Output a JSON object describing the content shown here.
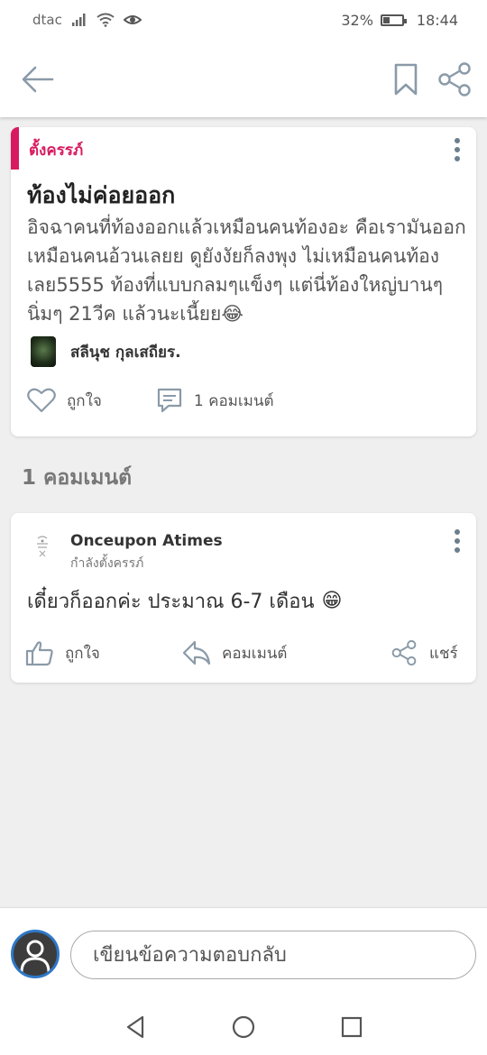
{
  "status_bar": {
    "carrier": "dtac",
    "battery_percent": "32%",
    "battery_level": 0.32,
    "time": "18:44",
    "icons": [
      "signal-icon",
      "wifi-icon",
      "eye-icon",
      "battery-icon"
    ]
  },
  "app_bar": {
    "icons": [
      "back-arrow-icon",
      "bookmark-icon",
      "share-icon"
    ],
    "icon_color": "#8a9aa8"
  },
  "post": {
    "category": "ตั้งครรภ์",
    "category_color": "#d81b60",
    "title": "ท้องไม่ค่อยออก",
    "body": "อิจฉาคนที่ท้องออกแล้วเหมือนคนท้องอะ คือเรามันออกเหมือนคนอ้วนเลยย ดูยังงัยก็ลงพุง ไม่เหมือนคนท้องเลย5555 ท้องที่แบบกลมๆแข็งๆ แต่นี่ท้องใหญ่บานๆนิ่มๆ 21วีค แล้วนะเนี้ยย😂",
    "author": "สลีนุช กุลเสถียร.",
    "like_label": "ถูกใจ",
    "comment_label": "1 คอมเมนต์"
  },
  "comments_section": {
    "heading": "1 คอมเมนต์"
  },
  "comment": {
    "name": "Onceupon Atimes",
    "status": "กำลังตั้งครรภ์",
    "text": "เดี๋ยวก็ออกค่ะ ประมาณ 6-7 เดือน",
    "emoji": "😁",
    "like_label": "ถูกใจ",
    "reply_label": "คอมเมนต์",
    "share_label": "แชร์"
  },
  "reply_bar": {
    "placeholder": "เขียนข้อความตอบกลับ"
  },
  "nav_bar": {
    "icons": [
      "back-triangle-icon",
      "home-circle-icon",
      "recents-square-icon"
    ]
  }
}
